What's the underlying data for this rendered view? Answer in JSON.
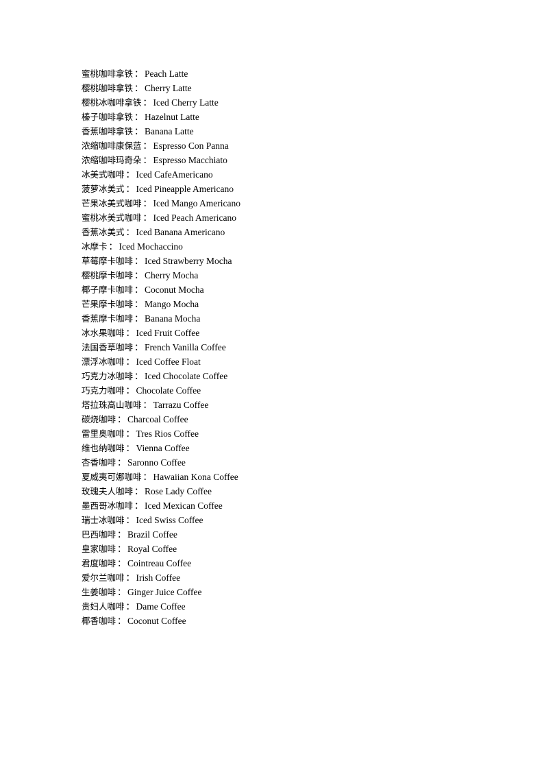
{
  "document": {
    "page_background": "#ffffff",
    "text_color": "#000000",
    "separator": "：",
    "entries": [
      {
        "cn": "蜜桃咖啡拿铁",
        "en": "Peach Latte"
      },
      {
        "cn": "樱桃咖啡拿铁",
        "en": "Cherry Latte"
      },
      {
        "cn": "樱桃冰咖啡拿铁",
        "en": "Iced Cherry Latte"
      },
      {
        "cn": "榛子咖啡拿铁",
        "en": "Hazelnut Latte"
      },
      {
        "cn": "香蕉咖啡拿铁",
        "en": "Banana Latte"
      },
      {
        "cn": "浓缩咖啡康保蓝",
        "en": "Espresso Con Panna"
      },
      {
        "cn": "浓缩咖啡玛奇朵",
        "en": "Espresso Macchiato"
      },
      {
        "cn": "冰美式咖啡",
        "en": "Iced CafeAmericano"
      },
      {
        "cn": "菠萝冰美式",
        "en": "Iced Pineapple Americano"
      },
      {
        "cn": "芒果冰美式咖啡",
        "en": "Iced Mango Americano"
      },
      {
        "cn": "蜜桃冰美式咖啡",
        "en": "Iced Peach Americano"
      },
      {
        "cn": "香蕉冰美式",
        "en": "Iced Banana Americano"
      },
      {
        "cn": "冰摩卡",
        "en": "Iced Mochaccino"
      },
      {
        "cn": "草莓摩卡咖啡",
        "en": "Iced Strawberry Mocha"
      },
      {
        "cn": "樱桃摩卡咖啡",
        "en": "Cherry Mocha"
      },
      {
        "cn": "椰子摩卡咖啡",
        "en": "Coconut Mocha"
      },
      {
        "cn": "芒果摩卡咖啡",
        "en": "Mango Mocha"
      },
      {
        "cn": "香蕉摩卡咖啡",
        "en": "Banana Mocha"
      },
      {
        "cn": "冰水果咖啡",
        "en": "Iced Fruit Coffee"
      },
      {
        "cn": "法国香草咖啡",
        "en": "French Vanilla Coffee"
      },
      {
        "cn": "漂浮冰咖啡",
        "en": "Iced Coffee Float"
      },
      {
        "cn": "巧克力冰咖啡",
        "en": "Iced Chocolate Coffee"
      },
      {
        "cn": "巧克力咖啡",
        "en": "Chocolate Coffee"
      },
      {
        "cn": "塔拉珠高山咖啡",
        "en": "Tarrazu Coffee"
      },
      {
        "cn": "碳烧咖啡",
        "en": "Charcoal Coffee"
      },
      {
        "cn": "雷里奥咖啡",
        "en": "Tres Rios Coffee"
      },
      {
        "cn": "维也纳咖啡",
        "en": "Vienna Coffee"
      },
      {
        "cn": "杏香咖啡",
        "en": "Saronno Coffee"
      },
      {
        "cn": "夏威夷可娜咖啡",
        "en": "Hawaiian Kona Coffee"
      },
      {
        "cn": "玫瑰夫人咖啡",
        "en": "Rose Lady Coffee"
      },
      {
        "cn": "墨西哥冰咖啡",
        "en": "Iced Mexican Coffee"
      },
      {
        "cn": "瑞士冰咖啡",
        "en": "Iced Swiss Coffee"
      },
      {
        "cn": "巴西咖啡",
        "en": "Brazil Coffee"
      },
      {
        "cn": "皇家咖啡",
        "en": "Royal Coffee"
      },
      {
        "cn": "君度咖啡",
        "en": "Cointreau Coffee"
      },
      {
        "cn": "爱尔兰咖啡",
        "en": "Irish Coffee"
      },
      {
        "cn": "生姜咖啡",
        "en": "Ginger Juice Coffee"
      },
      {
        "cn": "贵妇人咖啡",
        "en": "Dame Coffee"
      },
      {
        "cn": "椰香咖啡",
        "en": "Coconut Coffee"
      }
    ]
  }
}
